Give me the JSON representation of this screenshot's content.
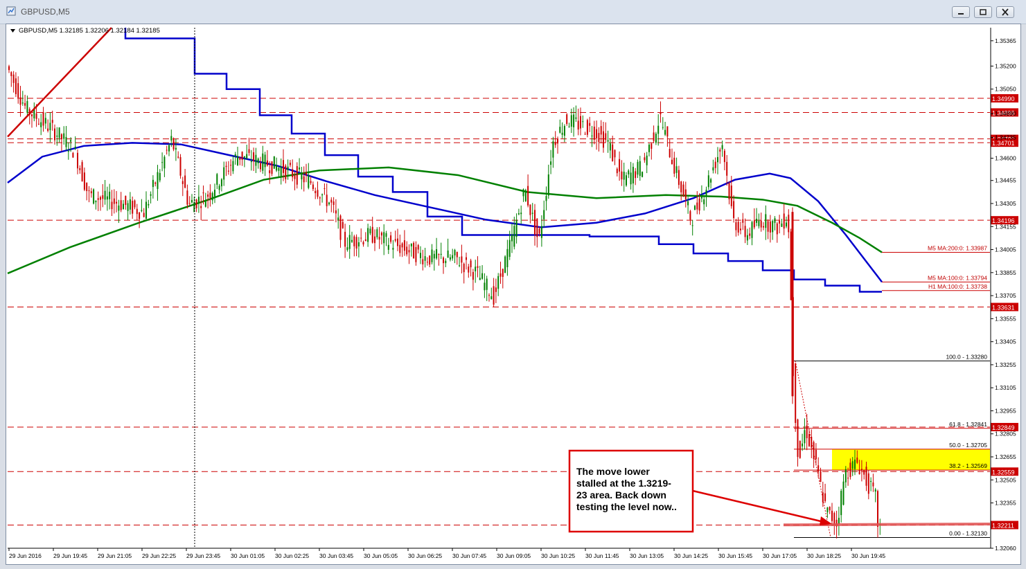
{
  "window": {
    "title": "GBPUSD,M5"
  },
  "chart_data": {
    "type": "candlestick",
    "symbol_line": "GBPUSD,M5  1.32185 1.32206 1.32184 1.32185",
    "y_range": [
      1.3206,
      1.3545
    ],
    "price_ticks": [
      "1.35365",
      "1.35200",
      "1.35050",
      "1.34890",
      "1.34735",
      "1.34600",
      "1.34455",
      "1.34305",
      "1.34155",
      "1.34005",
      "1.33855",
      "1.33705",
      "1.33555",
      "1.33405",
      "1.33255",
      "1.33105",
      "1.32955",
      "1.32805",
      "1.32655",
      "1.32505",
      "1.32355",
      "1.32060"
    ],
    "time_labels": [
      "29 Jun 2016",
      "29 Jun 19:45",
      "29 Jun 21:05",
      "29 Jun 22:25",
      "29 Jun 23:45",
      "30 Jun 01:05",
      "30 Jun 02:25",
      "30 Jun 03:45",
      "30 Jun 05:05",
      "30 Jun 06:25",
      "30 Jun 07:45",
      "30 Jun 09:05",
      "30 Jun 10:25",
      "30 Jun 11:45",
      "30 Jun 13:05",
      "30 Jun 14:25",
      "30 Jun 15:45",
      "30 Jun 17:05",
      "30 Jun 18:25",
      "30 Jun 19:45"
    ],
    "horizontal_levels": [
      {
        "value": 1.3499,
        "label": "1.34990"
      },
      {
        "value": 1.34898,
        "label": "1.34898"
      },
      {
        "value": 1.34726,
        "label": "1.34726"
      },
      {
        "value": 1.34701,
        "label": "1.34701"
      },
      {
        "value": 1.34196,
        "label": "1.34196"
      },
      {
        "value": 1.33631,
        "label": "1.33631"
      },
      {
        "value": 1.32849,
        "label": "1.32849"
      },
      {
        "value": 1.32559,
        "label": "1.32559"
      },
      {
        "value": 1.32211,
        "label": "1.32211"
      }
    ],
    "ma_labels": [
      {
        "text": "M5 MA:200:0: 1.33987",
        "value": 1.33987,
        "color": "#c00000",
        "line_color": "#008000"
      },
      {
        "text": "M5 MA:100:0: 1.33794",
        "value": 1.33794,
        "color": "#c00000",
        "line_color": "#0000cc"
      },
      {
        "text": "H1 MA:100:0: 1.33738",
        "value": 1.33738,
        "color": "#c00000",
        "line_color": "#0000cc"
      }
    ],
    "fibonacci": [
      {
        "text": "100.0 - 1.33280",
        "value": 1.3328
      },
      {
        "text": "61.8 - 1.32841",
        "value": 1.32841
      },
      {
        "text": "50.0 - 1.32705",
        "value": 1.32705
      },
      {
        "text": "38.2 - 1.32569",
        "value": 1.32569
      },
      {
        "text": "0.00 - 1.32130",
        "value": 1.3213
      }
    ],
    "annotation": [
      "The move lower",
      "stalled at the 1.3219-",
      "23 area. Back down",
      "testing the level now.."
    ],
    "colors": {
      "bull": "#008000",
      "bear": "#cc0000",
      "level": "#cc0000",
      "ma_blue": "#0000cc",
      "ma_green": "#008000",
      "fib_zone": "#ffff00"
    }
  }
}
